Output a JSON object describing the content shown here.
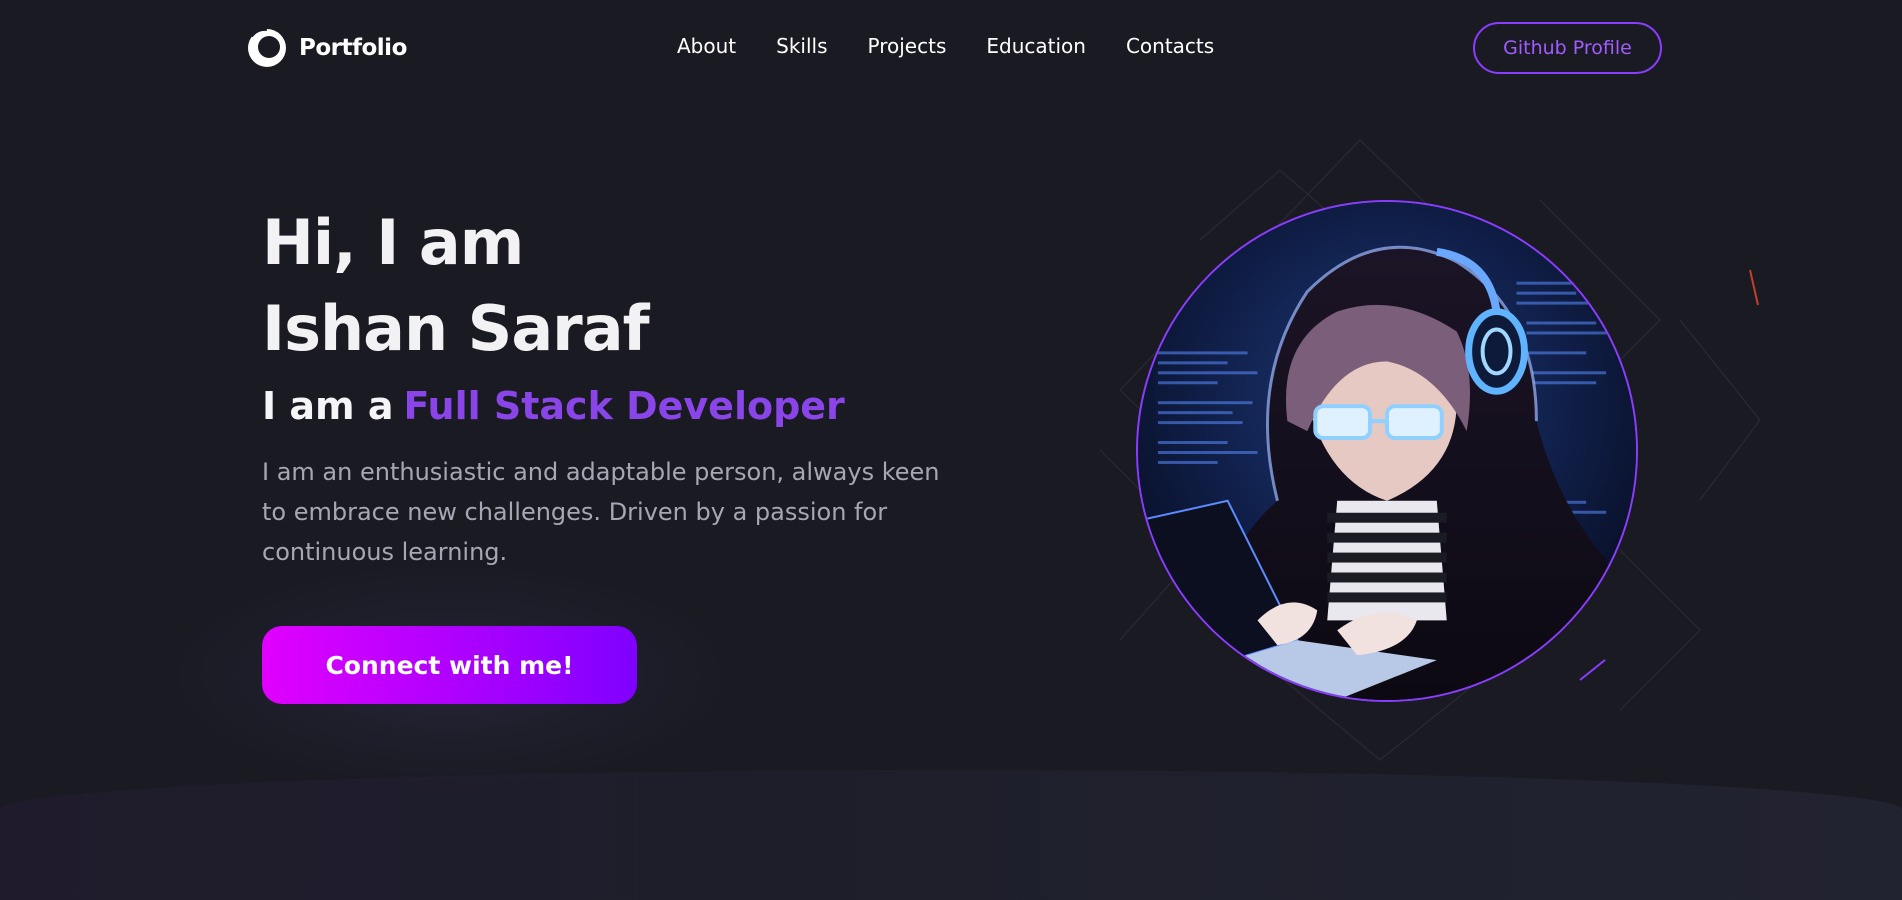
{
  "brand": {
    "name": "Portfolio",
    "logo_icon": "crescent-ring-logo-icon"
  },
  "nav": {
    "links": [
      "About",
      "Skills",
      "Projects",
      "Education",
      "Contacts"
    ],
    "github_button": "Github Profile"
  },
  "hero": {
    "greeting": "Hi, I am",
    "name": "Ishan Saraf",
    "role_prefix": "I am a",
    "role": "Full Stack Developer",
    "description": "I am an enthusiastic and adaptable person, always keen to embrace new challenges. Driven by a passion for continuous learning.",
    "cta": "Connect with me!"
  },
  "avatar": {
    "icon": "hooded-developer-avatar-image"
  },
  "colors": {
    "background": "#1a1a23",
    "accent": "#8a45e8",
    "cta_gradient_start": "#e100ff",
    "cta_gradient_end": "#7f00ff",
    "outline": "#8b3dff"
  }
}
